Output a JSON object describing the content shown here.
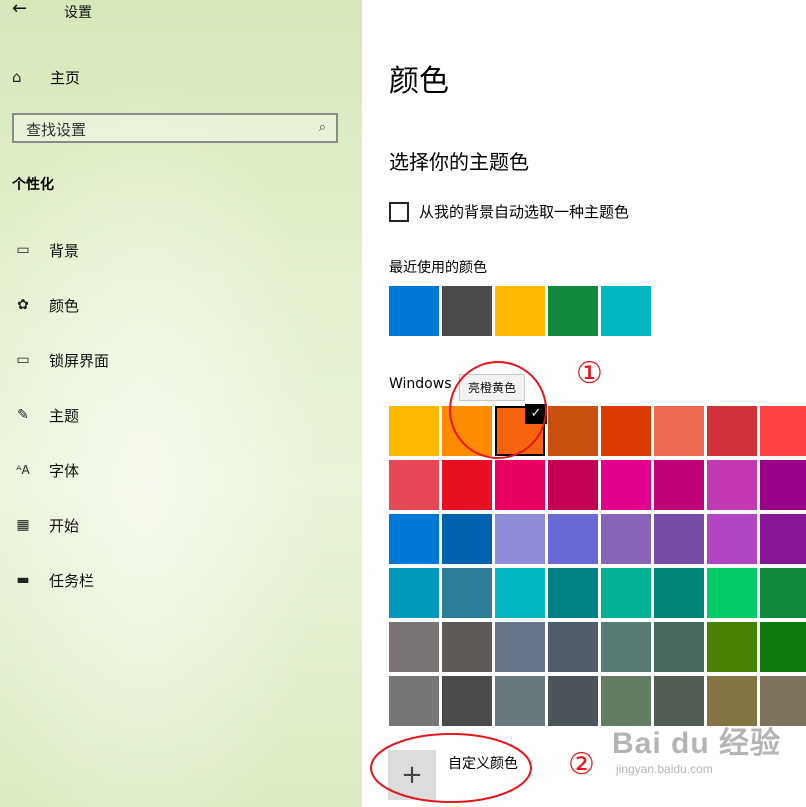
{
  "topbar": {
    "back_icon": "back-arrow-icon",
    "title": "设置"
  },
  "sidebar": {
    "home": {
      "icon": "home-icon",
      "label": "主页"
    },
    "search": {
      "placeholder": "查找设置",
      "icon": "search-icon"
    },
    "section": "个性化",
    "items": [
      {
        "icon": "picture-icon",
        "label": "背景"
      },
      {
        "icon": "palette-icon",
        "label": "颜色"
      },
      {
        "icon": "lockscreen-icon",
        "label": "锁屏界面"
      },
      {
        "icon": "theme-brush-icon",
        "label": "主题"
      },
      {
        "icon": "font-icon",
        "label": "字体"
      },
      {
        "icon": "start-icon",
        "label": "开始"
      },
      {
        "icon": "taskbar-icon",
        "label": "任务栏"
      }
    ]
  },
  "main": {
    "title": "颜色",
    "subtitle": "选择你的主题色",
    "auto_pick_label": "从我的背景自动选取一种主题色",
    "auto_pick_checked": false,
    "recent_label": "最近使用的颜色",
    "recent_colors": [
      "#0078d7",
      "#4c4a48",
      "#ffb900",
      "#10893e",
      "#00b7c3"
    ],
    "windows_label": "Windows",
    "tooltip": "亮橙黄色",
    "selected_color": "#f7630c",
    "grid": [
      [
        "#ffb900",
        "#ff8c00",
        "#f7630c",
        "#ca5010",
        "#da3b01",
        "#ef6950",
        "#d13438",
        "#ff4343"
      ],
      [
        "#e74856",
        "#e81123",
        "#ea005e",
        "#c30052",
        "#e3008c",
        "#bf0077",
        "#c239b3",
        "#9a0089"
      ],
      [
        "#0078d7",
        "#0063b1",
        "#8e8cd8",
        "#6b69d6",
        "#8764b8",
        "#744da9",
        "#b146c2",
        "#881798"
      ],
      [
        "#0099bc",
        "#2d7d9a",
        "#00b7c3",
        "#038387",
        "#00b294",
        "#018574",
        "#00cc6a",
        "#10893e"
      ],
      [
        "#7a7574",
        "#5d5a58",
        "#68768a",
        "#515c6b",
        "#567c73",
        "#486860",
        "#498205",
        "#107c10"
      ],
      [
        "#767676",
        "#4c4a48",
        "#69797e",
        "#4a5459",
        "#647c64",
        "#525e54",
        "#847545",
        "#7e735f"
      ]
    ],
    "custom_color": {
      "icon": "plus-icon",
      "label": "自定义颜色"
    }
  },
  "annotations": {
    "marker1": "①",
    "marker2": "②",
    "color": "#e8141c"
  },
  "watermark": {
    "logo": "Bai du 经验",
    "url": "jingyan.baidu.com"
  }
}
